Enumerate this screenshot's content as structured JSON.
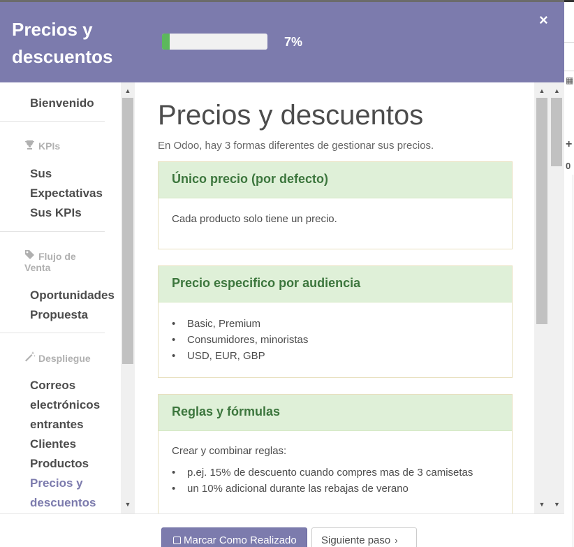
{
  "modal": {
    "title": "Precios y descuentos",
    "progress_percent": 7,
    "progress_label": "7%",
    "close_glyph": "×"
  },
  "sidebar": {
    "welcome": "Bienvenido",
    "sections": [
      {
        "title": "KPIs",
        "icon": "trophy-icon",
        "items": [
          "Sus Expectativas",
          "Sus KPIs"
        ]
      },
      {
        "title": "Flujo de Venta",
        "icon": "tag-icon",
        "items": [
          "Oportunidades",
          "Propuesta"
        ]
      },
      {
        "title": "Despliegue",
        "icon": "magic-wand-icon",
        "items": [
          "Correos electrónicos entrantes",
          "Clientes",
          "Productos",
          "Precios y descuentos"
        ]
      }
    ],
    "active_item": "Precios y descuentos"
  },
  "content": {
    "heading": "Precios y descuentos",
    "intro": "En Odoo, hay 3 formas diferentes de gestionar sus precios.",
    "cards": [
      {
        "title": "Único precio (por defecto)",
        "text": "Cada producto solo tiene un precio."
      },
      {
        "title": "Precio especifico por audiencia",
        "bullets": [
          "Basic, Premium",
          "Consumidores, minoristas",
          "USD, EUR, GBP"
        ]
      },
      {
        "title": "Reglas y fórmulas",
        "text": "Crear y combinar reglas:",
        "bullets": [
          "p.ej. 15% de descuento cuando compres mas de 3 camisetas",
          "un 10% adicional durante las rebajas de verano"
        ]
      }
    ]
  },
  "footer": {
    "done_label": "Marcar Como Realizado",
    "next_label": "Siguiente paso"
  },
  "colors": {
    "header_bg": "#7c7bad",
    "progress_fill": "#5cb85c",
    "card_header_bg": "#dff0d8",
    "card_header_text": "#3c763d",
    "active_link": "#7c7bad"
  }
}
